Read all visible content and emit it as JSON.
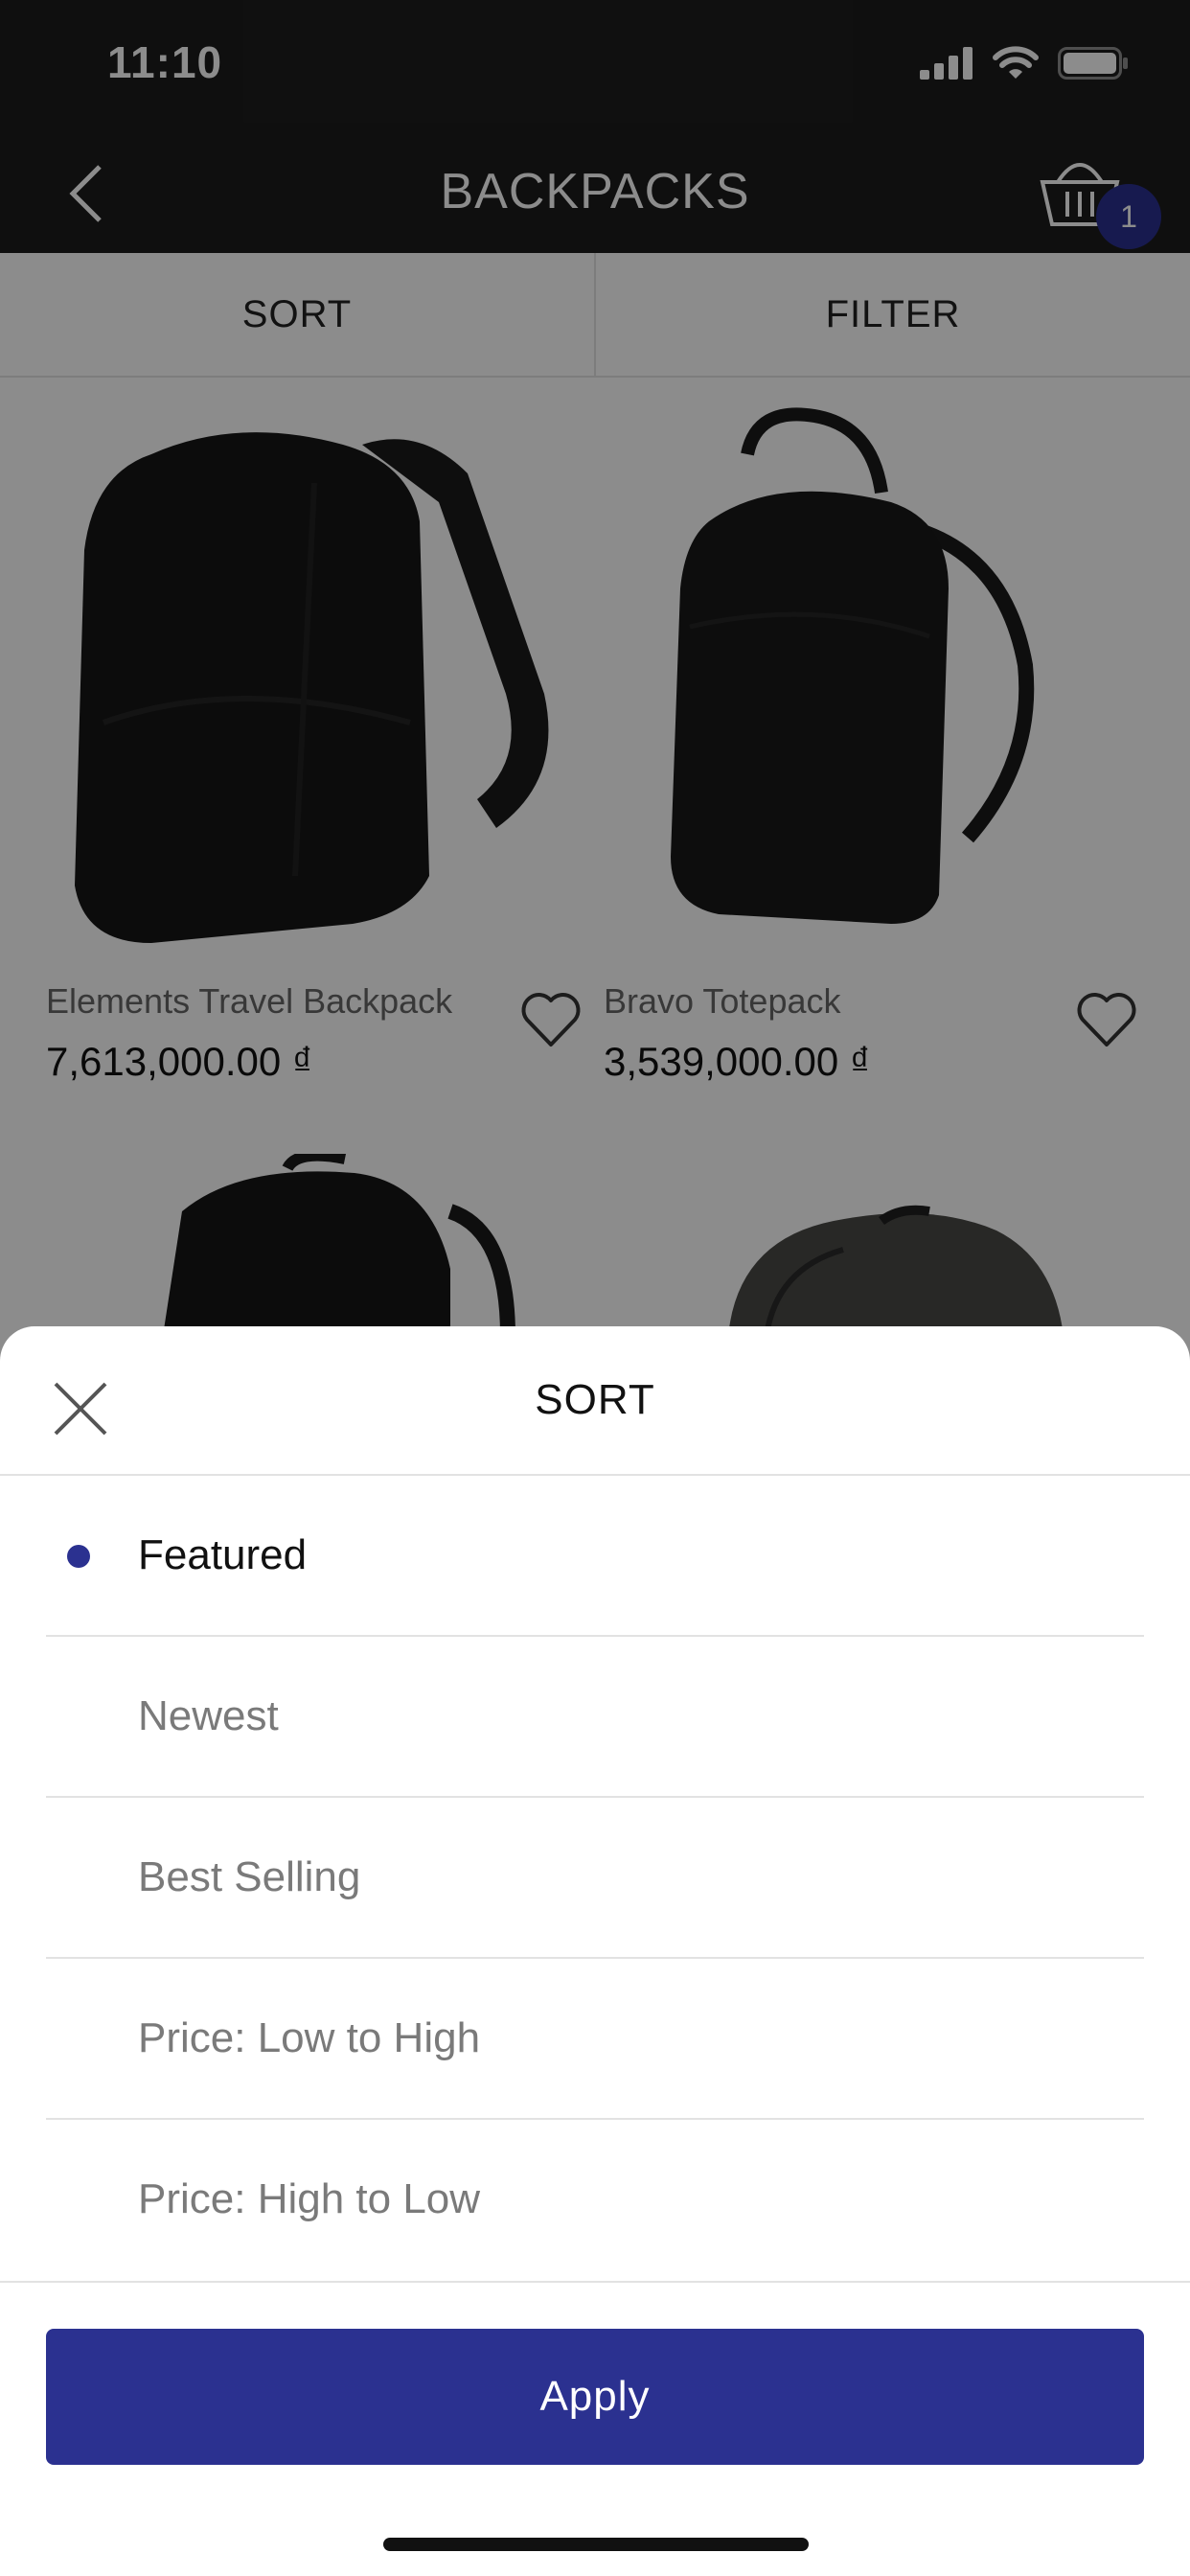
{
  "status_bar": {
    "time": "11:10"
  },
  "nav": {
    "title": "BACKPACKS",
    "cart_count": "1"
  },
  "tabs": [
    {
      "label": "SORT"
    },
    {
      "label": "FILTER"
    }
  ],
  "products": [
    {
      "name": "Elements Travel Backpack",
      "price": "7,613,000.00 ₫"
    },
    {
      "name": "Bravo Totepack",
      "price": "3,539,000.00 ₫"
    }
  ],
  "sort_sheet": {
    "title": "SORT",
    "options": [
      {
        "label": "Featured",
        "selected": true
      },
      {
        "label": "Newest",
        "selected": false
      },
      {
        "label": "Best Selling",
        "selected": false
      },
      {
        "label": "Price: Low to High",
        "selected": false
      },
      {
        "label": "Price: High to Low",
        "selected": false
      }
    ],
    "apply_label": "Apply"
  },
  "colors": {
    "accent": "#2b3190",
    "header_bg": "#1d1d1d"
  }
}
